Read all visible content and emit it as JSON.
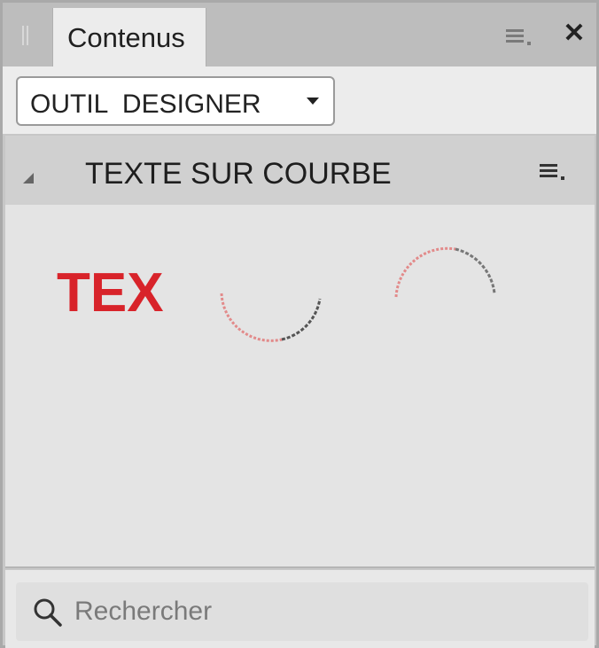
{
  "tab": {
    "label": "Contenus"
  },
  "toolbar": {
    "dropdown_value": "OUTIL  DESIGNER"
  },
  "section": {
    "title": "TEXTE SUR COURBE",
    "items": [
      {
        "preview_text": "TEX",
        "icon": "text-on-curve-straight"
      },
      {
        "icon": "text-on-curve-bottom-arc"
      },
      {
        "icon": "text-on-curve-top-arc"
      }
    ]
  },
  "search": {
    "placeholder": "Rechercher"
  },
  "colors": {
    "accent_red": "#d8232a",
    "panel_bg": "#e4e4e4"
  }
}
